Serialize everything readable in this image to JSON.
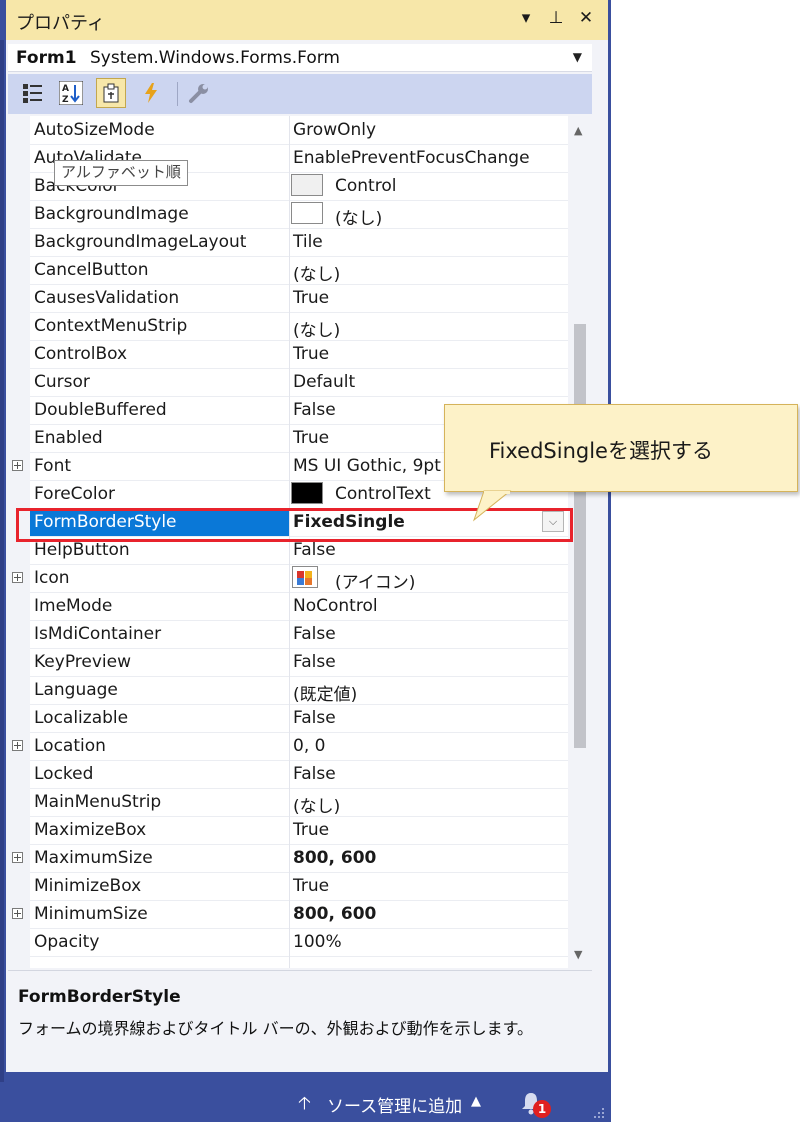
{
  "panel": {
    "title": "プロパティ",
    "window_buttons": [
      "▾",
      "⊥",
      "✕"
    ]
  },
  "object_selector": {
    "name": "Form1",
    "type": "System.Windows.Forms.Form"
  },
  "toolbar": {
    "buttons": [
      {
        "name": "categorized",
        "icon": "categorized-icon",
        "active": false
      },
      {
        "name": "alphabetical",
        "icon": "alphabetical-icon",
        "active": false
      },
      {
        "name": "properties",
        "icon": "properties-icon",
        "active": true
      },
      {
        "name": "events",
        "icon": "lightning-icon",
        "active": false
      },
      {
        "name": "property-pages",
        "icon": "wrench-icon",
        "active": false
      }
    ],
    "tooltip": "アルファベット順"
  },
  "properties": [
    {
      "name": "AutoSizeMode",
      "value": "GrowOnly"
    },
    {
      "name": "AutoValidate",
      "value": "EnablePreventFocusChange"
    },
    {
      "name": "BackColor",
      "value": "Control",
      "swatch": "#f0f0f0"
    },
    {
      "name": "BackgroundImage",
      "value": "(なし)",
      "swatch": "#ffffff"
    },
    {
      "name": "BackgroundImageLayout",
      "value": "Tile"
    },
    {
      "name": "CancelButton",
      "value": "(なし)"
    },
    {
      "name": "CausesValidation",
      "value": "True"
    },
    {
      "name": "ContextMenuStrip",
      "value": "(なし)"
    },
    {
      "name": "ControlBox",
      "value": "True"
    },
    {
      "name": "Cursor",
      "value": "Default"
    },
    {
      "name": "DoubleBuffered",
      "value": "False"
    },
    {
      "name": "Enabled",
      "value": "True"
    },
    {
      "name": "Font",
      "value": "MS UI Gothic, 9pt",
      "expandable": true
    },
    {
      "name": "ForeColor",
      "value": "ControlText",
      "swatch": "#000000"
    },
    {
      "name": "FormBorderStyle",
      "value": "FixedSingle",
      "selected": true,
      "bold": true
    },
    {
      "name": "HelpButton",
      "value": "False"
    },
    {
      "name": "Icon",
      "value": "(アイコン)",
      "expandable": true,
      "icon": true
    },
    {
      "name": "ImeMode",
      "value": "NoControl"
    },
    {
      "name": "IsMdiContainer",
      "value": "False"
    },
    {
      "name": "KeyPreview",
      "value": "False"
    },
    {
      "name": "Language",
      "value": "(既定値)"
    },
    {
      "name": "Localizable",
      "value": "False"
    },
    {
      "name": "Location",
      "value": "0, 0",
      "expandable": true
    },
    {
      "name": "Locked",
      "value": "False"
    },
    {
      "name": "MainMenuStrip",
      "value": "(なし)"
    },
    {
      "name": "MaximizeBox",
      "value": "True"
    },
    {
      "name": "MaximumSize",
      "value": "800, 600",
      "expandable": true,
      "bold": true
    },
    {
      "name": "MinimizeBox",
      "value": "True"
    },
    {
      "name": "MinimumSize",
      "value": "800, 600",
      "expandable": true,
      "bold": true
    },
    {
      "name": "Opacity",
      "value": "100%"
    }
  ],
  "callout": {
    "text": "FixedSingleを選択する"
  },
  "description": {
    "title": "FormBorderStyle",
    "text": "フォームの境界線およびタイトル バーの、外観および動作を示します。"
  },
  "statusbar": {
    "label": "ソース管理に追加",
    "notification_count": "1"
  },
  "colors": {
    "accent": "#0a78d7",
    "frame": "#3a4f9e",
    "titlebar": "#f7e7a9",
    "highlight": "#e8232c"
  }
}
